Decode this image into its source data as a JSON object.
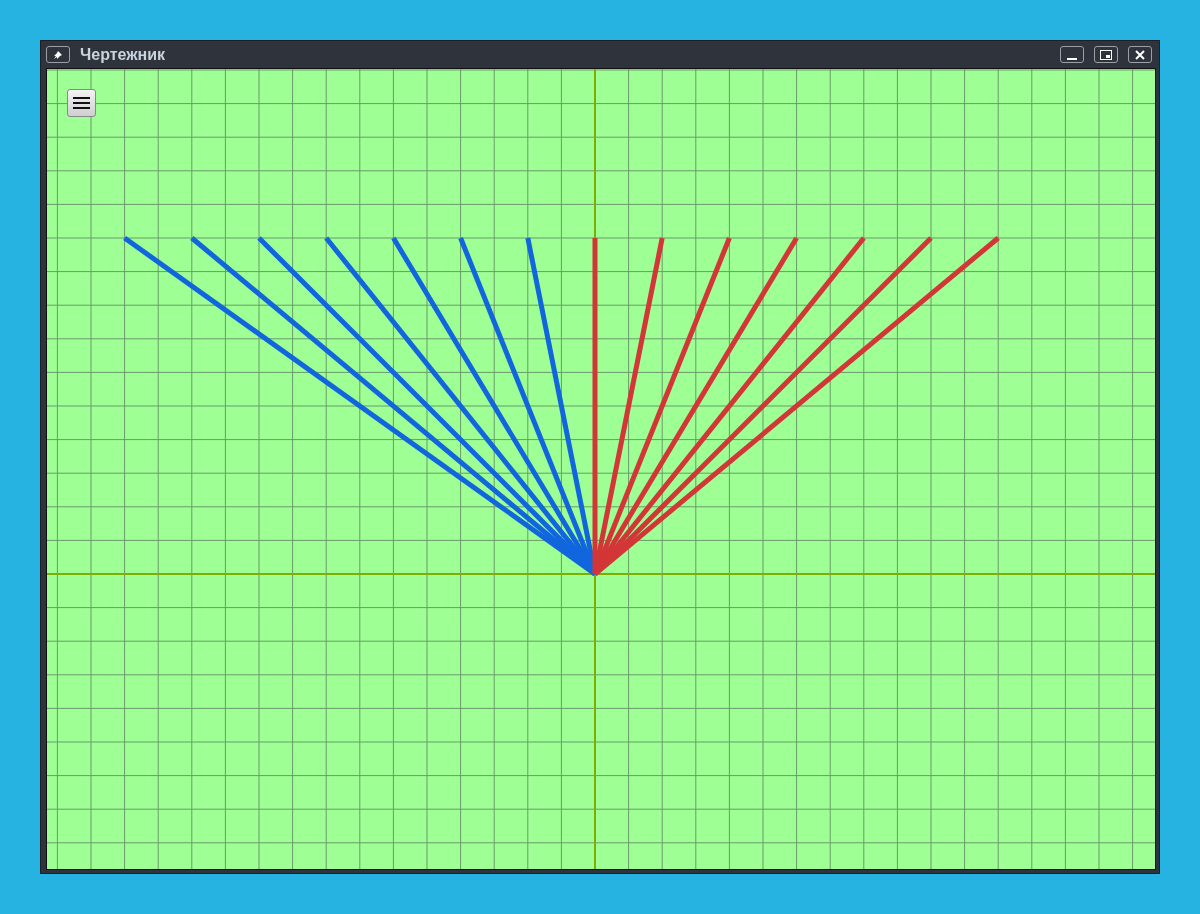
{
  "window": {
    "title": "Чертежник"
  }
}
